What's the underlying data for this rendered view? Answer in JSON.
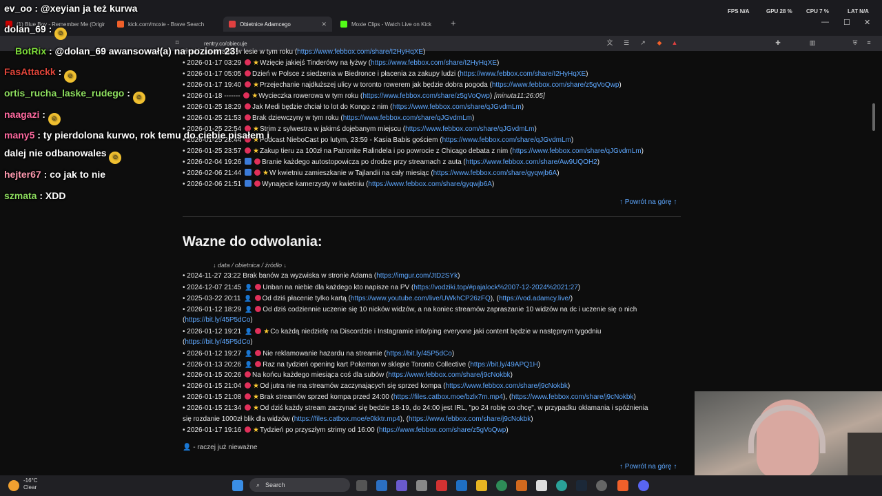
{
  "browser": {
    "tabs": [
      {
        "title": "(1) Blue Boy - Remember Me (Origin",
        "color": "#c00"
      },
      {
        "title": "kick.com/moxie - Brave Search",
        "color": "#f0602a"
      },
      {
        "title": "Obietnice Adamcego",
        "color": "#e04040"
      },
      {
        "title": "Moxie Clips - Watch Live on Kick",
        "color": "#53fc18"
      }
    ],
    "new_tab": "+",
    "url": "rentry.co/obiecuje",
    "stats": {
      "fps": "FPS N/A",
      "gpu": "GPU 28 %",
      "cpu": "CPU 7 %",
      "lat": "LAT N/A"
    },
    "window_controls": {
      "minimize": "—",
      "maximize": "☐",
      "close": "✕"
    }
  },
  "section1": {
    "rows": [
      {
        "date": "",
        "text": "vivał i nocowanie w lesie w tym roku (",
        "link": "https://www.febbox.com/share/I2HyHqXE",
        "tail": ")"
      },
      {
        "date": "2026-01-17 03:29",
        "text": "Wzięcie jakiejś Tinderówy na łyżwy (",
        "link": "https://www.febbox.com/share/I2HyHqXE",
        "tail": ")"
      },
      {
        "date": "2026-01-17 05:05",
        "text": "Dzień w Polsce z siedzenia w Biedronce i płacenia za zakupy ludzi (",
        "link": "https://www.febbox.com/share/I2HyHqXE",
        "tail": ")"
      },
      {
        "date": "2026-01-17 19:40",
        "text": "Przejechanie najdłuższej ulicy w toronto rowerem jak będzie dobra pogoda (",
        "link": "https://www.febbox.com/share/z5gVoQwp",
        "tail": ")"
      },
      {
        "date": "2026-01-18 -------",
        "text": "Wycieczka rowerowa w tym roku (",
        "link": "https://www.febbox.com/share/z5gVoQwp",
        "tail": ")",
        "minute": "[minuta11:26:05]"
      },
      {
        "date": "2026-01-25 18:29",
        "text": "Jak Medi będzie chciał to lot do Kongo z nim (",
        "link": "https://www.febbox.com/share/qJGvdmLm",
        "tail": ")"
      },
      {
        "date": "2026-01-25 21:53",
        "text": "Brak dziewczyny w tym roku (",
        "link": "https://www.febbox.com/share/qJGvdmLm",
        "tail": ")"
      },
      {
        "date": "2026-01-25 22:54",
        "text": "Strim z sylwestra w jakimś dojebanym miejscu (",
        "link": "https://www.febbox.com/share/qJGvdmLm",
        "tail": ")"
      },
      {
        "date": "2026-01-25 23:44",
        "text": "Podcast NieboCast po lutym, 23:59 - Kasia Babis gościem (",
        "link": "https://www.febbox.com/share/qJGvdmLm",
        "tail": ")"
      },
      {
        "date": "2026-01-25 23:57",
        "text": "Zakup tieru za 100zł na Patronite Ralindela i po powrocie z Chicago debata z nim (",
        "link": "https://www.febbox.com/share/qJGvdmLm",
        "tail": ")"
      },
      {
        "date": "2026-02-04 19:26",
        "text": "Branie każdego autostopowicza po drodze przy streamach z auta (",
        "link": "https://www.febbox.com/share/Aw9UQOH2",
        "tail": ")"
      },
      {
        "date": "2026-02-06 21:44",
        "text": "W kwietniu zamieszkanie w Tajlandii na cały miesiąc (",
        "link": "https://www.febbox.com/share/gyqwjb6A",
        "tail": ")"
      },
      {
        "date": "2026-02-06 21:51",
        "text": "Wynajęcie kamerzysty w kwietniu (",
        "link": "https://www.febbox.com/share/gyqwjb6A",
        "tail": ")"
      }
    ],
    "back_to_top": "↑ Powrót na górę ↑"
  },
  "section2": {
    "heading": "Wazne do odwolania:",
    "legend": "↓ data / obietnica / źródło ↓",
    "rows": [
      {
        "date": "2024-11-27 23:22",
        "text": "Brak banów za wyzwiska w stronie Adama (",
        "link": "https://imgur.com/JtD2SYk",
        "tail": ")"
      },
      {
        "date": "2024-12-07 21:45",
        "text": "Unban na niebie dla każdego kto napisze na PV (",
        "link": "https://vodziki.top/#pajalock%2007-12-2024%2021:27",
        "tail": ")"
      },
      {
        "date": "2025-03-22 20:11",
        "text": "Od dziś płacenie tylko kartą (",
        "link": "https://www.youtube.com/live/UWkhCP26zFQ",
        "tail": "), (",
        "link2": "https://vod.adamcy.live/",
        "tail2": ")"
      },
      {
        "date": "2026-01-12 18:29",
        "text": "Od dziś codziennie uczenie się 10 nicków widzów, a na koniec streamów zapraszanie 10 widzów na dc i uczenie się o nich",
        "link": "",
        "tail": ""
      },
      {
        "date": "",
        "text": "(",
        "link": "https://bit.ly/45P5dCo",
        "tail": ")"
      },
      {
        "date": "2026-01-12 19:21",
        "text": "Co każdą niedzielę na Discordzie i Instagramie info/ping everyone jaki content będzie w następnym tygodniu",
        "link": "",
        "tail": ""
      },
      {
        "date": "",
        "text": "(",
        "link": "https://bit.ly/45P5dCo",
        "tail": ")"
      },
      {
        "date": "2026-01-12 19:27",
        "text": "Nie reklamowanie hazardu na streamie (",
        "link": "https://bit.ly/45P5dCo",
        "tail": ")"
      },
      {
        "date": "2026-01-13 20:26",
        "text": "Raz na tydzień opening kart Pokemon w sklepie Toronto Collective (",
        "link": "https://bit.ly/49APQ1H",
        "tail": ")"
      },
      {
        "date": "2026-01-15 20:26",
        "text": "Na końcu każdego miesiąca coś dla subów (",
        "link": "https://www.febbox.com/share/j9cNokbk",
        "tail": ")"
      },
      {
        "date": "2026-01-15 21:04",
        "text": "Od jutra nie ma streamów zaczynających się sprzed kompa (",
        "link": "https://www.febbox.com/share/j9cNokbk",
        "tail": ")"
      },
      {
        "date": "2026-01-15 21:08",
        "text": "Brak streamów sprzed kompa przed 24:00 (",
        "link": "https://files.catbox.moe/bzlx7m.mp4",
        "tail": "), (",
        "link2": "https://www.febbox.com/share/j9cNokbk",
        "tail2": ")"
      },
      {
        "date": "2026-01-15 21:34",
        "text": "Od dziś każdy stream zaczynać się będzie 18-19, do 24:00 jest IRL, \"po 24 robię co chcę\", w przypadku okłamania i spóźnienia",
        "link": "",
        "tail": ""
      },
      {
        "date": "",
        "text": "się rozdanie 1000zł blik dla widzów (",
        "link": "https://files.catbox.moe/e0kktr.mp4",
        "tail": "), (",
        "link2": "https://www.febbox.com/share/j9cNokbk",
        "tail2": ")"
      },
      {
        "date": "2026-01-17 19:16",
        "text": "Tydzień po przyszłym strimy od 16:00 (",
        "link": "https://www.febbox.com/share/z5gVoQwp",
        "tail": ")"
      }
    ],
    "footnote": "👤 - raczej już nieważne",
    "back_to_top": "↑ Powrót na górę ↑"
  },
  "chat": [
    {
      "user": "ev_oo",
      "color": "#ffffff",
      "text": ": @xeyian ja też kurwa"
    },
    {
      "user": "dolan_69",
      "color": "#ffffff",
      "text": ":"
    },
    {
      "user": "BotRix",
      "color": "#7ddc3a",
      "text": ": @dolan_69 awansował(a) na poziom 23!"
    },
    {
      "user": "FasAttackk",
      "color": "#e0453a",
      "text": ":"
    },
    {
      "user": "ortis_rucha_laske_rudego",
      "color": "#8fe060",
      "text": ":"
    },
    {
      "user": "naagazi",
      "color": "#ff6aa0",
      "text": ":"
    },
    {
      "user": "many5",
      "color": "#ff6aa0",
      "text": ": ty pierdolona kurwo, rok temu do ciebie pisałem i"
    },
    {
      "user": "",
      "color": "#ffffff",
      "text": "dalej nie odbanowales"
    },
    {
      "user": "hejter67",
      "color": "#ff9ab0",
      "text": ": co jak to nie"
    },
    {
      "user": "szmata",
      "color": "#8fe060",
      "text": ": XDD"
    }
  ],
  "taskbar": {
    "weather_temp": "-16°C",
    "weather_desc": "Clear",
    "search": "Search"
  }
}
